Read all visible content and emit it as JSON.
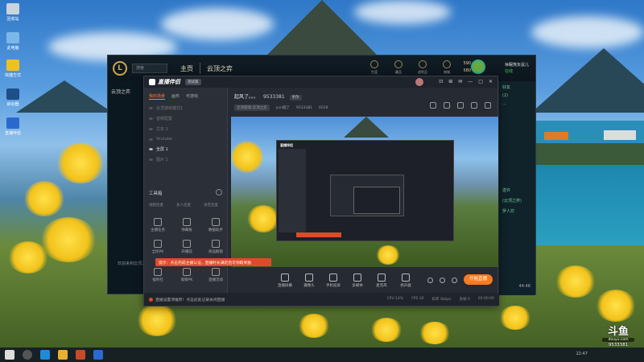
{
  "desktop": {
    "icons": [
      {
        "label": "回收站"
      },
      {
        "label": "此电脑"
      },
      {
        "label": "快捷方式"
      },
      {
        "label": "启动器"
      },
      {
        "label": "直播伴侣"
      }
    ]
  },
  "lol": {
    "search_placeholder": "搜索",
    "nav_home": "主页",
    "nav_tft": "云顶之弈",
    "side_title": "云顶之弈",
    "right_buttons": [
      "生涯",
      "藏品",
      "战利品",
      "商城"
    ],
    "currency_1": "590",
    "currency_2": "580",
    "username": "休眠熊负鼠儿",
    "status": "在线",
    "right_panel": [
      "好友",
      "(2)",
      "..."
    ],
    "rp_item1": "送许",
    "rp_item2": "(云顶之弈)",
    "rp_item3": "罗人炊",
    "left_text": "欢迎来到云顶之弈",
    "bottom_icon": "44:48"
  },
  "live": {
    "app_name": "直播伴侣",
    "beta": "测试版",
    "window_buttons": [
      "⊡",
      "⊞",
      "✉",
      "—",
      "□",
      "✕"
    ],
    "tabs": [
      "我的场景",
      "画布",
      "可游戏"
    ],
    "scenes": [
      {
        "label": "云顶游戏模式1",
        "on": false
      },
      {
        "label": "音频配置",
        "on": false
      },
      {
        "label": "文本 1",
        "on": false
      },
      {
        "label": "Youtube",
        "on": false
      },
      {
        "label": "全屏 1",
        "on": true
      },
      {
        "label": "图片 1",
        "on": false
      }
    ],
    "toolbox_title": "工具箱",
    "tool_row1": [
      "视频连麦",
      "多人连麦",
      "语音连麦"
    ],
    "tool_row2": [
      "主播任务",
      "弹幕板",
      "数据助手"
    ],
    "tool_row3": [
      "全民PK",
      "开播前",
      "商品橱窗"
    ],
    "tool_row4": [
      "福利社",
      "观察PK",
      "直播活动"
    ],
    "tip": "提示：点击完成主播认证，直播时长满足后可领取奖励",
    "room_title": "起风了。。。",
    "room_id": "9533381",
    "room_tag": "更改",
    "meta_category": "云顶游戏-云顶之弈",
    "meta_user": "yun眠了",
    "meta_id": "9533381",
    "meta_hot": "6019",
    "bottom_buttons": [
      "直播屏幕",
      "摄像头",
      "手机投屏",
      "多媒体",
      "麦克风",
      "扬声器"
    ],
    "start_button": "开始直播",
    "status_text": "直播设置项推荐！点击此处记录关闭直播",
    "status_right": [
      "CPU 14%",
      "FPS 30",
      "码率 0kbps",
      "丢帧 0",
      "00:00:00"
    ]
  },
  "watermark": {
    "mark": "斗鱼",
    "sub": "douyu.com",
    "room": "9533381"
  },
  "taskbar": {
    "tray": "22:47"
  }
}
